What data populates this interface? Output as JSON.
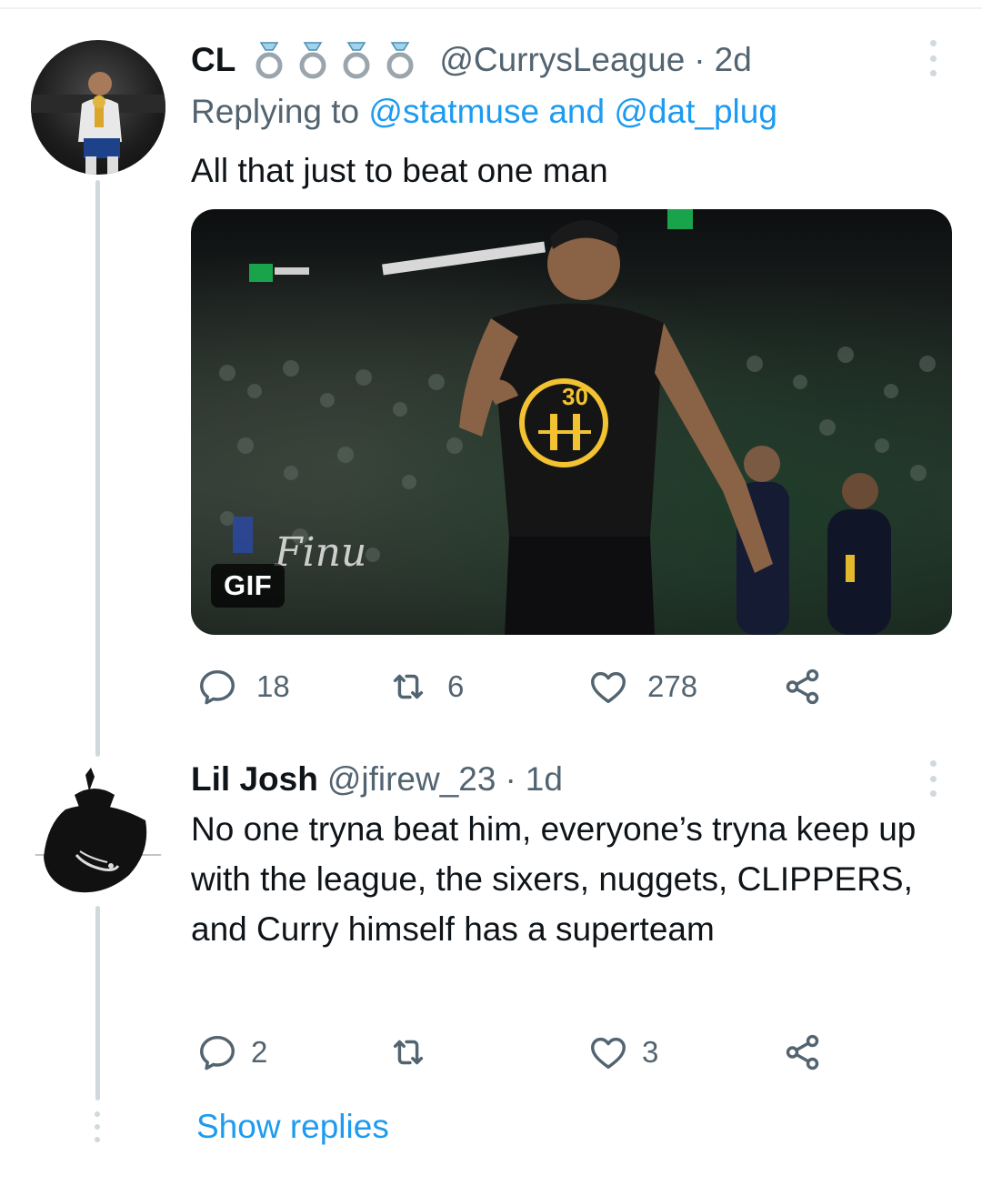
{
  "tweet": {
    "display_name": "CL",
    "badges": [
      "ring-icon",
      "ring-icon",
      "ring-icon",
      "ring-icon"
    ],
    "handle": "@CurrysLeague",
    "dot": "·",
    "time": "2d",
    "replying_prefix": "Replying to ",
    "replying_mention_1": "@statmuse",
    "replying_joiner": " and ",
    "replying_mention_2": "@dat_plug",
    "text": "All that just to beat one man",
    "media_badge": "GIF",
    "replies": "18",
    "retweets": "6",
    "likes": "278"
  },
  "reply": {
    "display_name": "Lil Josh",
    "handle": "@jfirew_23",
    "dot": "·",
    "time": "1d",
    "text": "No one tryna beat him, everyone’s tryna keep up with the league, the sixers, nuggets, CLIPPERS, and Curry himself has a superteam",
    "replies": "2",
    "retweets": "",
    "likes": "3"
  },
  "show_replies_label": "Show replies",
  "colors": {
    "link": "#1d9bf0",
    "muted": "#536471",
    "text": "#0f1419",
    "thread_line": "#cfd9de"
  },
  "icons": {
    "reply": "reply-bubble-icon",
    "retweet": "retweet-icon",
    "like": "heart-icon",
    "share": "share-icon",
    "more": "more-vertical-icon"
  }
}
